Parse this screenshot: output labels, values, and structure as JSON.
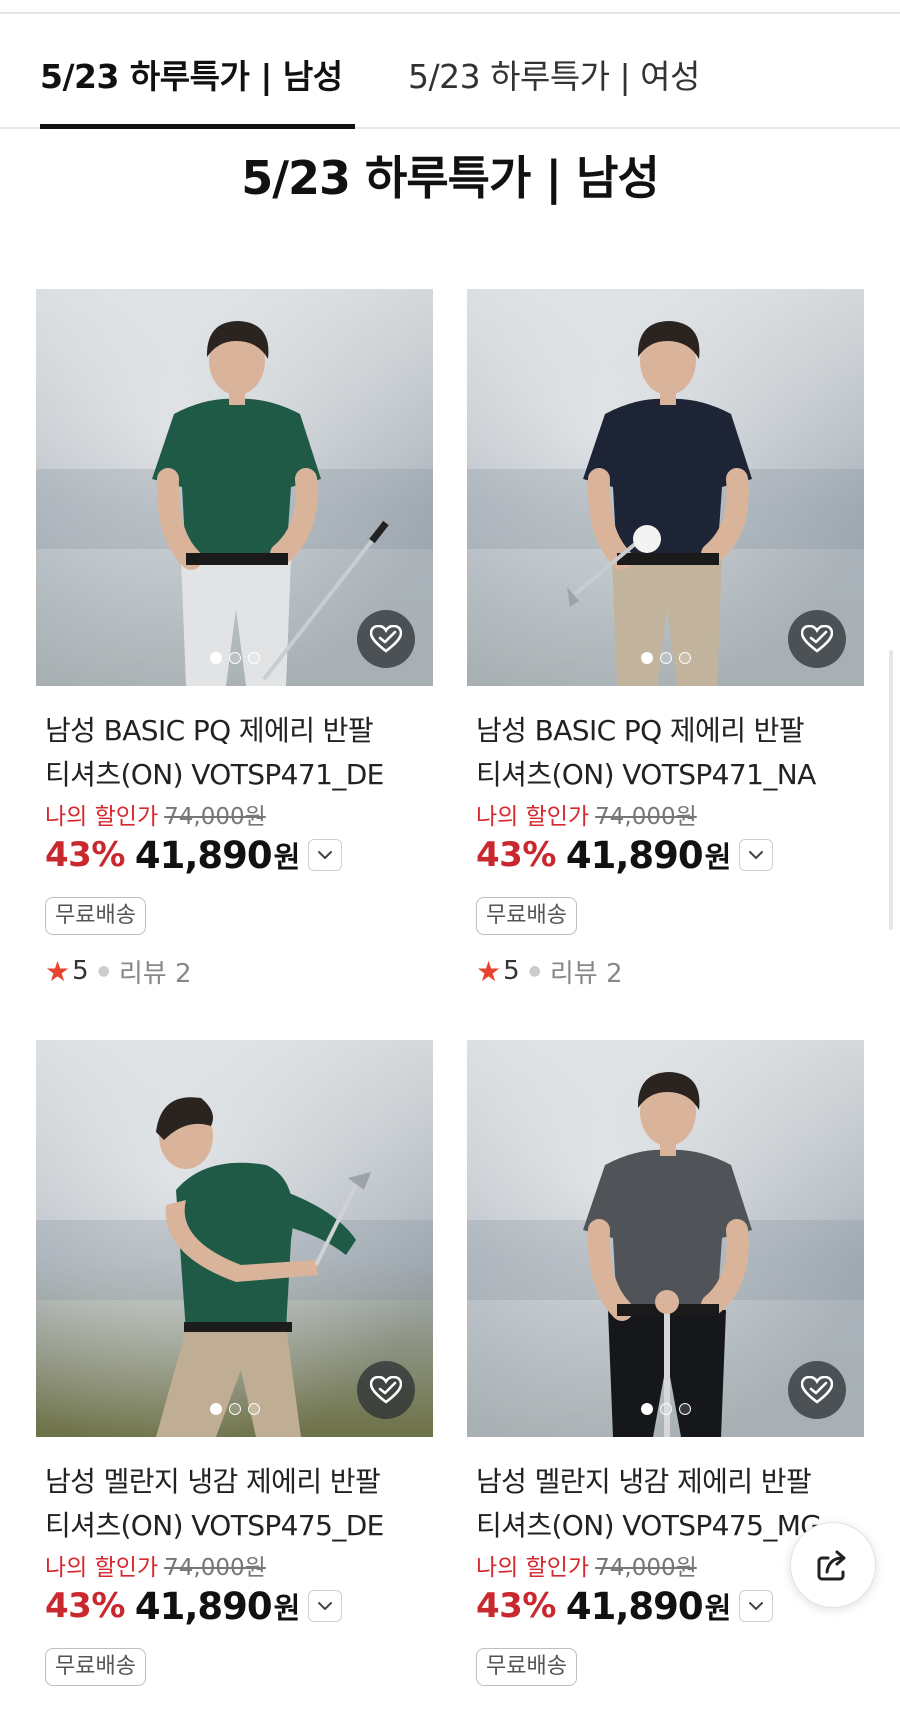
{
  "tabs": [
    {
      "label": "5/23 하루특가 |  남성",
      "active": true
    },
    {
      "label": "5/23 하루특가 |  여성",
      "active": false
    }
  ],
  "section": {
    "title": "5/23 하루특가 |  남성"
  },
  "products": [
    {
      "name_line1": "남성 BASIC PQ 제에리 반팔",
      "name_line2": "티셔츠(ON) VOTSP471_DE",
      "discount_label": "나의 할인가",
      "original_price": "74,000원",
      "discount_pct": "43%",
      "price": "41,890",
      "currency": "원",
      "shipping": "무료배송",
      "rating": "5",
      "reviews": "리뷰 2",
      "shirt_color": "#1f5a47",
      "pants_color": "#e2e3e5",
      "image_count": 3,
      "active_image": 1
    },
    {
      "name_line1": "남성 BASIC PQ 제에리 반팔",
      "name_line2": "티셔츠(ON) VOTSP471_NA",
      "discount_label": "나의 할인가",
      "original_price": "74,000원",
      "discount_pct": "43%",
      "price": "41,890",
      "currency": "원",
      "shipping": "무료배송",
      "rating": "5",
      "reviews": "리뷰 2",
      "shirt_color": "#1d2435",
      "pants_color": "#c2b49c",
      "image_count": 3,
      "active_image": 1
    },
    {
      "name_line1": "남성 멜란지 냉감 제에리 반팔",
      "name_line2": "티셔츠(ON) VOTSP475_DE",
      "discount_label": "나의 할인가",
      "original_price": "74,000원",
      "discount_pct": "43%",
      "price": "41,890",
      "currency": "원",
      "shipping": "무료배송",
      "shirt_color": "#1f5a47",
      "pants_color": "#bfae93",
      "image_count": 3,
      "active_image": 1
    },
    {
      "name_line1": "남성 멜란지 냉감 제에리 반팔",
      "name_line2": "티셔츠(ON) VOTSP475_MG",
      "discount_label": "나의 할인가",
      "original_price": "74,000원",
      "discount_pct": "43%",
      "price": "41,890",
      "currency": "원",
      "shipping": "무료배송",
      "shirt_color": "#505459",
      "pants_color": "#15171b",
      "image_count": 3,
      "active_image": 1
    }
  ],
  "icons": {
    "wishlist": "heart-check-icon",
    "price_toggle": "chevron-down-icon",
    "star": "star-icon",
    "share": "share-icon"
  },
  "colors": {
    "accent_red": "#c8282e",
    "star": "#e8432f",
    "text": "#111111",
    "muted": "#888888"
  }
}
